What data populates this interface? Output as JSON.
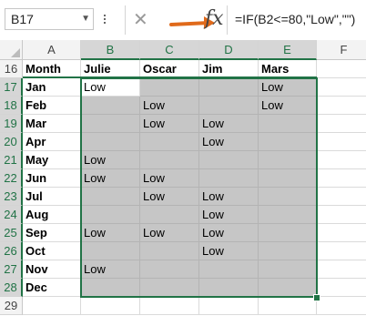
{
  "formula_bar": {
    "name_box": "B17",
    "formula": "=IF(B2<=80,\"Low\",\"\")",
    "cancel_glyph": "✕",
    "fx_glyph": "fx"
  },
  "columns": [
    "A",
    "B",
    "C",
    "D",
    "E",
    "F"
  ],
  "header_row": {
    "row_number": "16",
    "cells": [
      "Month",
      "Julie",
      "Oscar",
      "Jim",
      "Mars",
      ""
    ]
  },
  "rows": [
    {
      "row_number": "17",
      "cells": [
        "Jan",
        "Low",
        "",
        "",
        "Low",
        ""
      ]
    },
    {
      "row_number": "18",
      "cells": [
        "Feb",
        "",
        "Low",
        "",
        "Low",
        ""
      ]
    },
    {
      "row_number": "19",
      "cells": [
        "Mar",
        "",
        "Low",
        "Low",
        "",
        ""
      ]
    },
    {
      "row_number": "20",
      "cells": [
        "Apr",
        "",
        "",
        "Low",
        "",
        ""
      ]
    },
    {
      "row_number": "21",
      "cells": [
        "May",
        "Low",
        "",
        "",
        "",
        ""
      ]
    },
    {
      "row_number": "22",
      "cells": [
        "Jun",
        "Low",
        "Low",
        "",
        "",
        ""
      ]
    },
    {
      "row_number": "23",
      "cells": [
        "Jul",
        "",
        "Low",
        "Low",
        "",
        ""
      ]
    },
    {
      "row_number": "24",
      "cells": [
        "Aug",
        "",
        "",
        "Low",
        "",
        ""
      ]
    },
    {
      "row_number": "25",
      "cells": [
        "Sep",
        "Low",
        "Low",
        "Low",
        "",
        ""
      ]
    },
    {
      "row_number": "26",
      "cells": [
        "Oct",
        "",
        "",
        "Low",
        "",
        ""
      ]
    },
    {
      "row_number": "27",
      "cells": [
        "Nov",
        "Low",
        "",
        "",
        "",
        ""
      ]
    },
    {
      "row_number": "28",
      "cells": [
        "Dec",
        "",
        "",
        "",
        "",
        ""
      ]
    },
    {
      "row_number": "29",
      "cells": [
        "",
        "",
        "",
        "",
        "",
        ""
      ]
    }
  ],
  "colors": {
    "selection": "#217346",
    "selected_fill": "#c6c6c6",
    "arrow": "#e06a1b"
  },
  "icons": [
    "cancel-icon",
    "enter-arrow-icon",
    "fx-icon",
    "dropdown-icon",
    "more-dots-icon"
  ]
}
